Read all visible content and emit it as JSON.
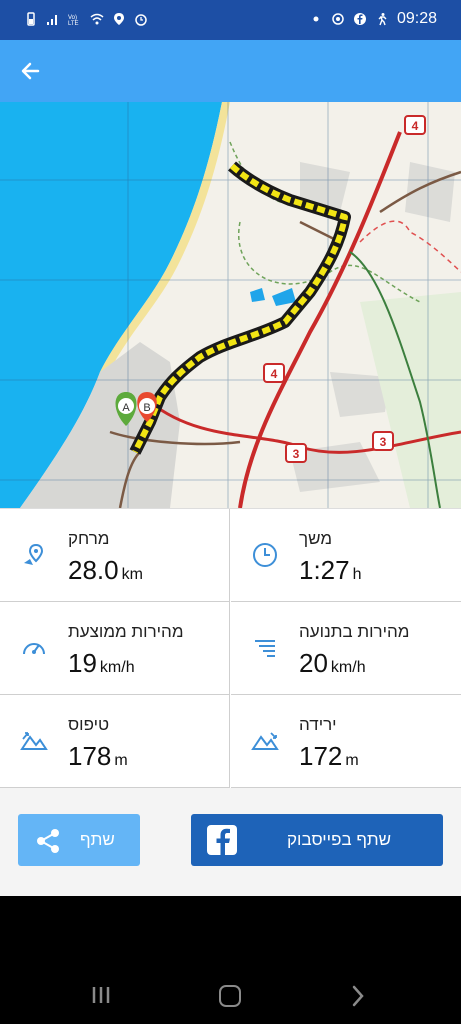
{
  "status_bar": {
    "time": "09:28",
    "left_icons": [
      "battery-icon",
      "signal-icon",
      "volte-icon",
      "wifi-icon",
      "location-icon",
      "alarm-icon"
    ],
    "right_icons": [
      "notification-dot-icon",
      "sync-icon",
      "facebook-icon",
      "running-icon"
    ]
  },
  "app_bar": {
    "back_icon": "arrow-left-icon",
    "color": "#42A5F5"
  },
  "map": {
    "route_color": "#F2E514",
    "markers": [
      {
        "label": "A",
        "color": "#5DAA3C"
      },
      {
        "label": "B",
        "color": "#E8492F"
      }
    ],
    "road_shields": [
      "4",
      "4",
      "3",
      "3"
    ]
  },
  "stats": [
    {
      "label": "מרחק",
      "value": "28.0",
      "unit": "km",
      "icon": "location-distance-icon"
    },
    {
      "label": "משך",
      "value": "1:27",
      "unit": "h",
      "icon": "clock-icon"
    },
    {
      "label": "מהירות ממוצעת",
      "value": "19",
      "unit": "km/h",
      "icon": "speedometer-icon"
    },
    {
      "label": "מהירות בתנועה",
      "value": "20",
      "unit": "km/h",
      "icon": "speed-lines-icon"
    },
    {
      "label": "טיפוס",
      "value": "178",
      "unit": "m",
      "icon": "mountain-up-icon"
    },
    {
      "label": "ירידה",
      "value": "172",
      "unit": "m",
      "icon": "mountain-down-icon"
    }
  ],
  "actions": {
    "share_label": "שתף",
    "facebook_label": "שתף בפייסבוק"
  },
  "nav": {
    "icons": [
      "recent-apps-icon",
      "home-icon",
      "back-nav-icon"
    ]
  }
}
